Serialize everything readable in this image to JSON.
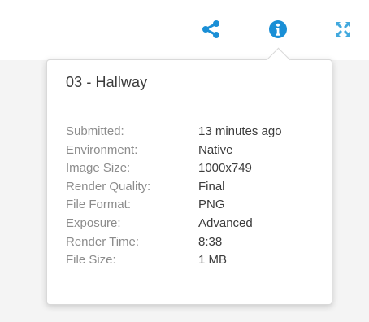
{
  "toolbar": {
    "share_icon": "share-icon",
    "info_icon": "info-icon",
    "expand_icon": "expand-icon",
    "accent_color": "#1a8fd6"
  },
  "popover": {
    "title": "03 - Hallway",
    "details": [
      {
        "label": "Submitted:",
        "value": "13 minutes ago"
      },
      {
        "label": "Environment:",
        "value": "Native"
      },
      {
        "label": "Image Size:",
        "value": "1000x749"
      },
      {
        "label": "Render Quality:",
        "value": "Final"
      },
      {
        "label": "File Format:",
        "value": "PNG"
      },
      {
        "label": "Exposure:",
        "value": "Advanced"
      },
      {
        "label": "Render Time:",
        "value": "8:38"
      },
      {
        "label": "File Size:",
        "value": "1 MB"
      }
    ]
  }
}
